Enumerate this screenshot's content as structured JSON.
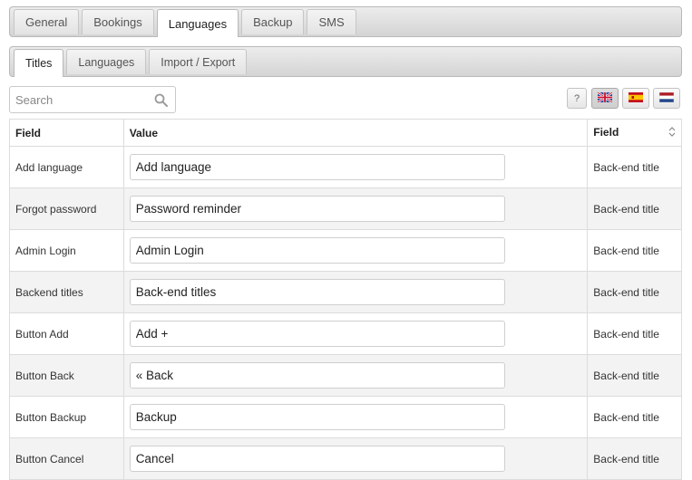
{
  "main_tabs": [
    "General",
    "Bookings",
    "Languages",
    "Backup",
    "SMS"
  ],
  "main_active": 2,
  "sub_tabs": [
    "Titles",
    "Languages",
    "Import / Export"
  ],
  "sub_active": 0,
  "search": {
    "placeholder": "Search"
  },
  "help": "?",
  "languages": [
    "english-flag-icon",
    "spanish-flag-icon",
    "dutch-flag-icon"
  ],
  "table": {
    "headers": [
      "Field",
      "Value",
      "Field"
    ],
    "rows": [
      {
        "label": "Add language",
        "value": "Add language",
        "type": "Back-end title"
      },
      {
        "label": "Forgot password",
        "value": "Password reminder",
        "type": "Back-end title"
      },
      {
        "label": "Admin Login",
        "value": "Admin Login",
        "type": "Back-end title"
      },
      {
        "label": "Backend titles",
        "value": "Back-end titles",
        "type": "Back-end title"
      },
      {
        "label": "Button Add",
        "value": "Add +",
        "type": "Back-end title"
      },
      {
        "label": "Button Back",
        "value": "« Back",
        "type": "Back-end title"
      },
      {
        "label": "Button Backup",
        "value": "Backup",
        "type": "Back-end title"
      },
      {
        "label": "Button Cancel",
        "value": "Cancel",
        "type": "Back-end title"
      }
    ]
  }
}
